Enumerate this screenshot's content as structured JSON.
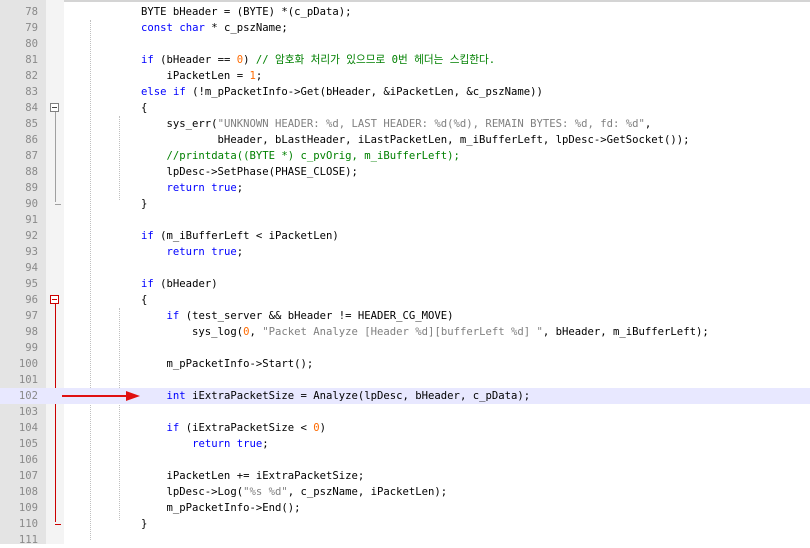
{
  "editor": {
    "lines": [
      {
        "n": "78",
        "tokens": [
          {
            "t": "        BYTE bHeader = (BYTE) *(c_pData);",
            "c": ""
          }
        ]
      },
      {
        "n": "79",
        "tokens": [
          {
            "t": "        ",
            "c": ""
          },
          {
            "t": "const",
            "c": "kw"
          },
          {
            "t": " ",
            "c": ""
          },
          {
            "t": "char",
            "c": "kw"
          },
          {
            "t": " * c_pszName;",
            "c": ""
          }
        ]
      },
      {
        "n": "80",
        "tokens": []
      },
      {
        "n": "81",
        "tokens": [
          {
            "t": "        ",
            "c": ""
          },
          {
            "t": "if",
            "c": "kw"
          },
          {
            "t": " (bHeader == ",
            "c": ""
          },
          {
            "t": "0",
            "c": "num"
          },
          {
            "t": ") ",
            "c": ""
          },
          {
            "t": "// 암호화 처리가 있으므로 0번 헤더는 스킵한다.",
            "c": "cmt"
          }
        ]
      },
      {
        "n": "82",
        "tokens": [
          {
            "t": "            iPacketLen = ",
            "c": ""
          },
          {
            "t": "1",
            "c": "num"
          },
          {
            "t": ";",
            "c": ""
          }
        ]
      },
      {
        "n": "83",
        "tokens": [
          {
            "t": "        ",
            "c": ""
          },
          {
            "t": "else",
            "c": "kw"
          },
          {
            "t": " ",
            "c": ""
          },
          {
            "t": "if",
            "c": "kw"
          },
          {
            "t": " (!m_pPacketInfo->Get(bHeader, &iPacketLen, &c_pszName))",
            "c": ""
          }
        ]
      },
      {
        "n": "84",
        "tokens": [
          {
            "t": "        {",
            "c": ""
          }
        ]
      },
      {
        "n": "85",
        "tokens": [
          {
            "t": "            sys_err(",
            "c": ""
          },
          {
            "t": "\"UNKNOWN HEADER: %d, LAST HEADER: %d(%d), REMAIN BYTES: %d, fd: %d\"",
            "c": "str"
          },
          {
            "t": ",",
            "c": ""
          }
        ]
      },
      {
        "n": "86",
        "tokens": [
          {
            "t": "                    bHeader, bLastHeader, iLastPacketLen, m_iBufferLeft, lpDesc->GetSocket());",
            "c": ""
          }
        ]
      },
      {
        "n": "87",
        "tokens": [
          {
            "t": "            ",
            "c": ""
          },
          {
            "t": "//printdata((BYTE *) c_pvOrig, m_iBufferLeft);",
            "c": "cmt"
          }
        ]
      },
      {
        "n": "88",
        "tokens": [
          {
            "t": "            lpDesc->SetPhase(PHASE_CLOSE);",
            "c": ""
          }
        ]
      },
      {
        "n": "89",
        "tokens": [
          {
            "t": "            ",
            "c": ""
          },
          {
            "t": "return",
            "c": "kw"
          },
          {
            "t": " ",
            "c": ""
          },
          {
            "t": "true",
            "c": "kw"
          },
          {
            "t": ";",
            "c": ""
          }
        ]
      },
      {
        "n": "90",
        "tokens": [
          {
            "t": "        }",
            "c": ""
          }
        ]
      },
      {
        "n": "91",
        "tokens": []
      },
      {
        "n": "92",
        "tokens": [
          {
            "t": "        ",
            "c": ""
          },
          {
            "t": "if",
            "c": "kw"
          },
          {
            "t": " (m_iBufferLeft < iPacketLen)",
            "c": ""
          }
        ]
      },
      {
        "n": "93",
        "tokens": [
          {
            "t": "            ",
            "c": ""
          },
          {
            "t": "return",
            "c": "kw"
          },
          {
            "t": " ",
            "c": ""
          },
          {
            "t": "true",
            "c": "kw"
          },
          {
            "t": ";",
            "c": ""
          }
        ]
      },
      {
        "n": "94",
        "tokens": []
      },
      {
        "n": "95",
        "tokens": [
          {
            "t": "        ",
            "c": ""
          },
          {
            "t": "if",
            "c": "kw"
          },
          {
            "t": " (bHeader)",
            "c": ""
          }
        ]
      },
      {
        "n": "96",
        "tokens": [
          {
            "t": "        {",
            "c": ""
          }
        ]
      },
      {
        "n": "97",
        "tokens": [
          {
            "t": "            ",
            "c": ""
          },
          {
            "t": "if",
            "c": "kw"
          },
          {
            "t": " (test_server && bHeader != HEADER_CG_MOVE)",
            "c": ""
          }
        ]
      },
      {
        "n": "98",
        "tokens": [
          {
            "t": "                sys_log(",
            "c": ""
          },
          {
            "t": "0",
            "c": "num"
          },
          {
            "t": ", ",
            "c": ""
          },
          {
            "t": "\"Packet Analyze [Header %d][bufferLeft %d] \"",
            "c": "str"
          },
          {
            "t": ", bHeader, m_iBufferLeft);",
            "c": ""
          }
        ]
      },
      {
        "n": "99",
        "tokens": []
      },
      {
        "n": "100",
        "tokens": [
          {
            "t": "            m_pPacketInfo->Start();",
            "c": ""
          }
        ]
      },
      {
        "n": "101",
        "tokens": []
      },
      {
        "n": "102",
        "tokens": [
          {
            "t": "            ",
            "c": ""
          },
          {
            "t": "int",
            "c": "kw"
          },
          {
            "t": " iExtraPacketSize = Analyze(lpDesc, bHeader, c_pData);",
            "c": ""
          }
        ]
      },
      {
        "n": "103",
        "tokens": []
      },
      {
        "n": "104",
        "tokens": [
          {
            "t": "            ",
            "c": ""
          },
          {
            "t": "if",
            "c": "kw"
          },
          {
            "t": " (iExtraPacketSize < ",
            "c": ""
          },
          {
            "t": "0",
            "c": "num"
          },
          {
            "t": ")",
            "c": ""
          }
        ]
      },
      {
        "n": "105",
        "tokens": [
          {
            "t": "                ",
            "c": ""
          },
          {
            "t": "return",
            "c": "kw"
          },
          {
            "t": " ",
            "c": ""
          },
          {
            "t": "true",
            "c": "kw"
          },
          {
            "t": ";",
            "c": ""
          }
        ]
      },
      {
        "n": "106",
        "tokens": []
      },
      {
        "n": "107",
        "tokens": [
          {
            "t": "            iPacketLen += iExtraPacketSize;",
            "c": ""
          }
        ]
      },
      {
        "n": "108",
        "tokens": [
          {
            "t": "            lpDesc->Log(",
            "c": ""
          },
          {
            "t": "\"%s %d\"",
            "c": "str"
          },
          {
            "t": ", c_pszName, iPacketLen);",
            "c": ""
          }
        ]
      },
      {
        "n": "109",
        "tokens": [
          {
            "t": "            m_pPacketInfo->End();",
            "c": ""
          }
        ]
      },
      {
        "n": "110",
        "tokens": [
          {
            "t": "        }",
            "c": ""
          }
        ]
      },
      {
        "n": "111",
        "tokens": []
      }
    ],
    "current_line": "102",
    "fold_open_lines": [
      "84",
      "96"
    ],
    "annotation": {
      "type": "arrow",
      "color": "#e01010",
      "points_to_line": "102"
    }
  }
}
